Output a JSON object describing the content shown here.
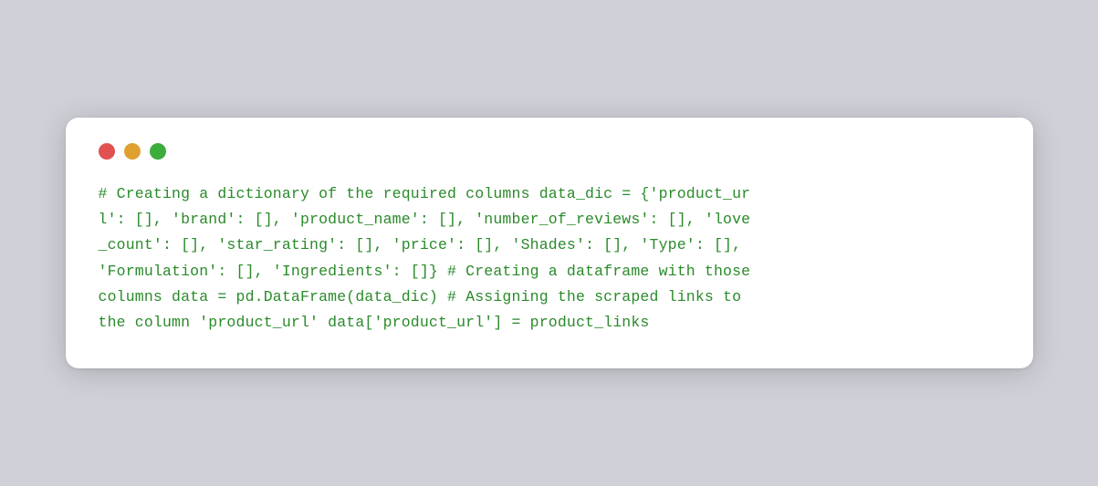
{
  "window": {
    "traffic_lights": {
      "red_label": "close",
      "yellow_label": "minimize",
      "green_label": "maximize"
    },
    "code": "# Creating a dictionary of the required columns data_dic = {'product_ur\nl': [], 'brand': [], 'product_name': [], 'number_of_reviews': [], 'love\n_count': [], 'star_rating': [], 'price': [], 'Shades': [], 'Type': [],\n'Formulation': [], 'Ingredients': []} # Creating a dataframe with those\ncolumns data = pd.DataFrame(data_dic) # Assigning the scraped links to\nthe column 'product_url' data['product_url'] = product_links"
  },
  "colors": {
    "red": "#e05252",
    "yellow": "#e0a030",
    "green": "#3cac3c",
    "code_text": "#2a8a2a"
  }
}
